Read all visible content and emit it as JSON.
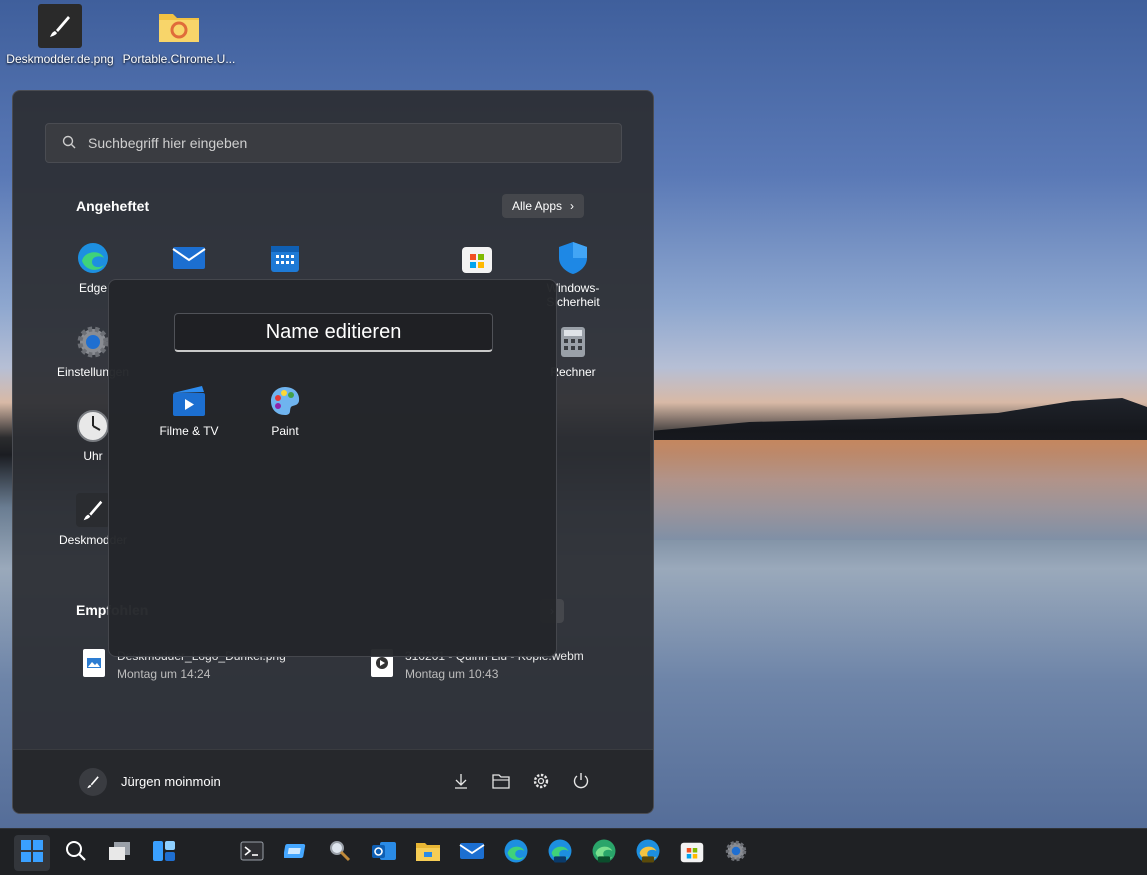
{
  "desktop": {
    "icons": [
      {
        "label": "Deskmodder.de.png"
      },
      {
        "label": "Portable.Chrome.U..."
      }
    ]
  },
  "start": {
    "search_placeholder": "Suchbegriff hier eingeben",
    "pinned_title": "Angeheftet",
    "all_apps": "Alle Apps",
    "pinned": [
      {
        "label": "Edge"
      },
      {
        "label": "Windows-Sicherheit"
      },
      {
        "label": "Einstellungen"
      },
      {
        "label": "Rechner"
      },
      {
        "label": "Uhr"
      },
      {
        "label": "Deskmodder"
      }
    ],
    "recommended_title": "Empfohlen",
    "recommended": [
      {
        "name": "Deskmodder_Logo_Dunkel.png",
        "time": "Montag um 14:24"
      },
      {
        "name": "310201 - Quinn Liu - Kopie.webm",
        "time": "Montag um 10:43"
      }
    ],
    "user": "Jürgen moinmoin"
  },
  "folder": {
    "name_value": "Name editieren",
    "apps": [
      {
        "label": "Filme & TV"
      },
      {
        "label": "Paint"
      }
    ]
  },
  "colors": {
    "accent": "#0078d4"
  }
}
